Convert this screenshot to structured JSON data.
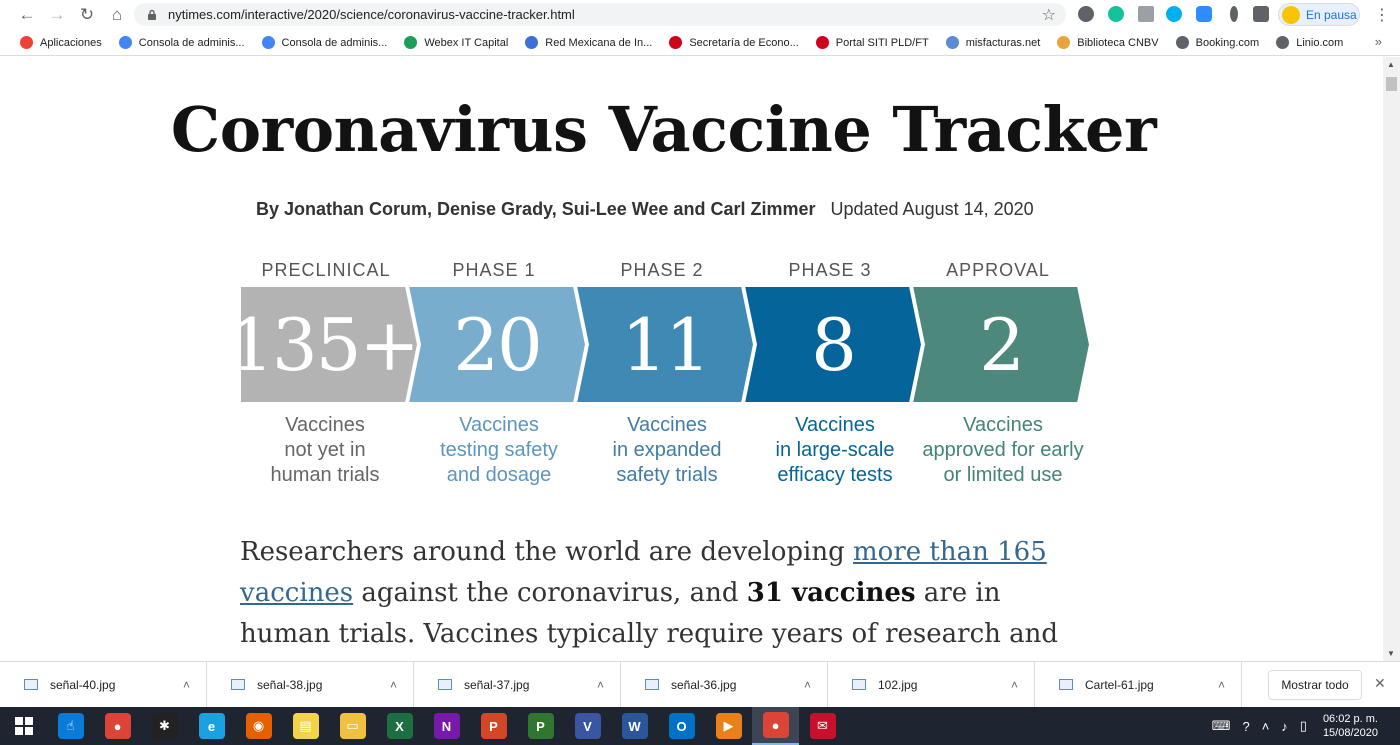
{
  "browser": {
    "url": "nytimes.com/interactive/2020/science/coronavirus-vaccine-tracker.html",
    "profile_label": "En pausa",
    "bookmarks": [
      {
        "label": "Aplicaciones",
        "icon": "apps-grid-icon",
        "color": "#ea4335"
      },
      {
        "label": "Consola de adminis...",
        "icon": "google-icon",
        "color": "#4285f4"
      },
      {
        "label": "Consola de adminis...",
        "icon": "google-icon",
        "color": "#4285f4"
      },
      {
        "label": "Webex IT Capital",
        "icon": "webex-icon",
        "color": "#1e9e5a"
      },
      {
        "label": "Red Mexicana de In...",
        "icon": "network-icon",
        "color": "#3c6fd8"
      },
      {
        "label": "Secretaría de Econo...",
        "icon": "red-circle-icon",
        "color": "#d0021b"
      },
      {
        "label": "Portal SITI PLD/FT",
        "icon": "red-circle-icon",
        "color": "#d0021b"
      },
      {
        "label": "misfacturas.net",
        "icon": "mf-icon",
        "color": "#5b8ad6"
      },
      {
        "label": "Biblioteca CNBV",
        "icon": "library-icon",
        "color": "#e8a33d"
      },
      {
        "label": "Booking.com",
        "icon": "globe-icon",
        "color": "#5f6368"
      },
      {
        "label": "Linio.com",
        "icon": "globe-icon",
        "color": "#5f6368"
      }
    ]
  },
  "article": {
    "headline": "Coronavirus Vaccine Tracker",
    "byline": "By Jonathan Corum, Denise Grady, Sui-Lee Wee and Carl Zimmer",
    "updated": "Updated August 14, 2020",
    "phases": [
      {
        "label": "PRECLINICAL",
        "count": "135+",
        "desc": [
          "Vaccines",
          "not yet in",
          "human trials"
        ],
        "color": "#b3b3b3",
        "text_color": "#666666"
      },
      {
        "label": "PHASE 1",
        "count": "20",
        "desc": [
          "Vaccines",
          "testing safety",
          "and dosage"
        ],
        "color": "#79adcd",
        "text_color": "#5b97bd"
      },
      {
        "label": "PHASE 2",
        "count": "11",
        "desc": [
          "Vaccines",
          "in expanded",
          "safety trials"
        ],
        "color": "#3f8ab5",
        "text_color": "#3f7ea8"
      },
      {
        "label": "PHASE 3",
        "count": "8",
        "desc": [
          "Vaccines",
          "in large-scale",
          "efficacy tests"
        ],
        "color": "#05659a",
        "text_color": "#05659a"
      },
      {
        "label": "APPROVAL",
        "count": "2",
        "desc": [
          "Vaccines",
          "approved for early",
          "or limited use"
        ],
        "color": "#4d887c",
        "text_color": "#41847a"
      }
    ],
    "body": {
      "part1": "Researchers around the world are developing ",
      "link": "more than 165 vaccines",
      "part2": " against the coronavirus, and ",
      "bold": "31 vaccines",
      "part3": " are in human trials. Vaccines typically require years of research and testing"
    }
  },
  "downloads": {
    "items": [
      "señal-40.jpg",
      "señal-38.jpg",
      "señal-37.jpg",
      "señal-36.jpg",
      "102.jpg",
      "Cartel-61.jpg"
    ],
    "show_all": "Mostrar todo"
  },
  "taskbar": {
    "apps": [
      {
        "name": "touch-app-icon",
        "color": "#0a7bd6",
        "glyph": "☝"
      },
      {
        "name": "chrome-icon",
        "color": "#db4437",
        "glyph": "●"
      },
      {
        "name": "paint-icon",
        "color": "#222222",
        "glyph": "✱"
      },
      {
        "name": "ie-icon",
        "color": "#1ba1e2",
        "glyph": "e"
      },
      {
        "name": "firefox-icon",
        "color": "#e66000",
        "glyph": "◉"
      },
      {
        "name": "sticky-notes-icon",
        "color": "#f3d34a",
        "glyph": "▤"
      },
      {
        "name": "file-explorer-icon",
        "color": "#f0c040",
        "glyph": "▭"
      },
      {
        "name": "excel-icon",
        "color": "#1d6f42",
        "glyph": "X"
      },
      {
        "name": "onenote-icon",
        "color": "#7719aa",
        "glyph": "N"
      },
      {
        "name": "powerpoint-icon",
        "color": "#d24726",
        "glyph": "P"
      },
      {
        "name": "project-icon",
        "color": "#31752f",
        "glyph": "P"
      },
      {
        "name": "visio-icon",
        "color": "#3955a3",
        "glyph": "V"
      },
      {
        "name": "word-icon",
        "color": "#2b579a",
        "glyph": "W"
      },
      {
        "name": "outlook-icon",
        "color": "#0072c6",
        "glyph": "O"
      },
      {
        "name": "media-player-icon",
        "color": "#e8811a",
        "glyph": "▶"
      },
      {
        "name": "chrome-active-icon",
        "color": "#db4437",
        "glyph": "●"
      },
      {
        "name": "app-red-icon",
        "color": "#c8102e",
        "glyph": "✉"
      }
    ],
    "time": "06:02 p. m.",
    "date": "15/08/2020"
  }
}
